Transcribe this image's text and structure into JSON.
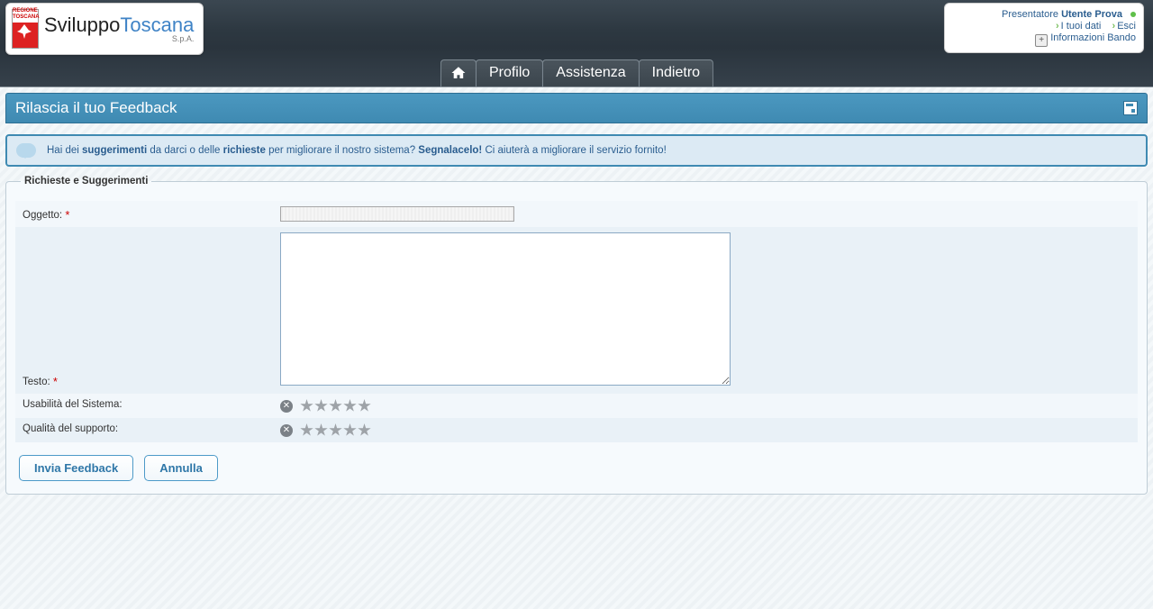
{
  "logo": {
    "region_line1": "REGIONE",
    "region_line2": "TOSCANA",
    "brand_a": "Sviluppo",
    "brand_b": "Toscana",
    "suffix": "S.p.A."
  },
  "user_box": {
    "role": "Presentatore",
    "name": "Utente Prova",
    "link_data": "I tuoi dati",
    "link_exit": "Esci",
    "link_info": "Informazioni Bando"
  },
  "nav": {
    "profile": "Profilo",
    "assist": "Assistenza",
    "back": "Indietro"
  },
  "panel": {
    "title": "Rilascia il tuo Feedback"
  },
  "info": {
    "t1": "Hai dei ",
    "b1": "suggerimenti",
    "t2": " da darci o delle ",
    "b2": "richieste",
    "t3": " per migliorare il nostro sistema? ",
    "b3": "Segnalacelo!",
    "t4": " Ci aiuterà a migliorare il servizio fornito!"
  },
  "fieldset": {
    "legend": "Richieste e Suggerimenti"
  },
  "form": {
    "subject_label": "Oggetto:",
    "subject_value": "",
    "body_label": "Testo:",
    "body_value": "",
    "usability_label": "Usabilità del Sistema:",
    "support_label": "Qualità del supporto:"
  },
  "buttons": {
    "submit": "Invia Feedback",
    "cancel": "Annulla"
  }
}
